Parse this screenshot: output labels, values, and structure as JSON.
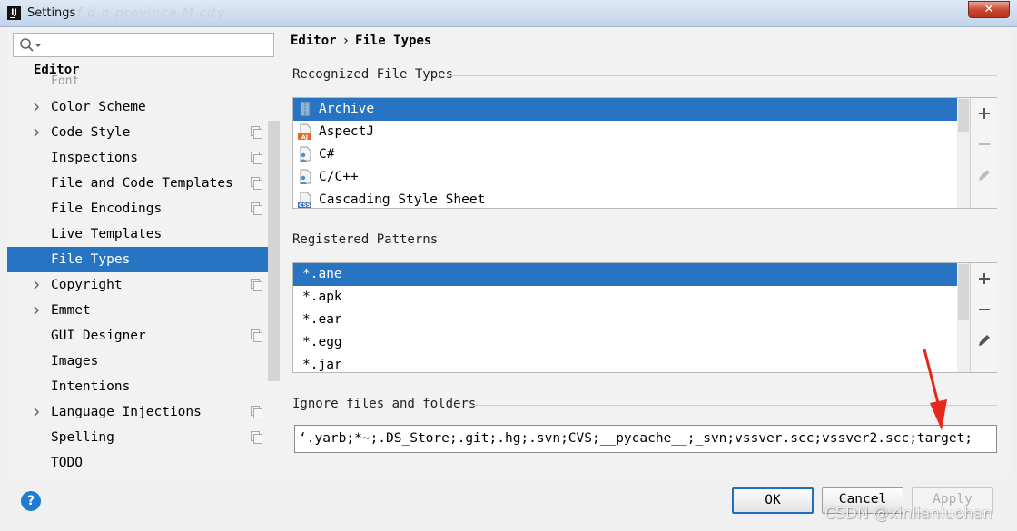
{
  "window": {
    "title": "Settings",
    "title_ghost": "f.d.n province M city",
    "close_label": "✕"
  },
  "search": {
    "value": ""
  },
  "tree": {
    "header": "Editor",
    "ghost": "Font",
    "items": [
      {
        "label": "Color Scheme",
        "expandable": true,
        "badge": false,
        "selected": false
      },
      {
        "label": "Code Style",
        "expandable": true,
        "badge": true,
        "selected": false
      },
      {
        "label": "Inspections",
        "expandable": false,
        "badge": true,
        "selected": false
      },
      {
        "label": "File and Code Templates",
        "expandable": false,
        "badge": true,
        "selected": false
      },
      {
        "label": "File Encodings",
        "expandable": false,
        "badge": true,
        "selected": false
      },
      {
        "label": "Live Templates",
        "expandable": false,
        "badge": false,
        "selected": false
      },
      {
        "label": "File Types",
        "expandable": false,
        "badge": false,
        "selected": true
      },
      {
        "label": "Copyright",
        "expandable": true,
        "badge": true,
        "selected": false
      },
      {
        "label": "Emmet",
        "expandable": true,
        "badge": false,
        "selected": false
      },
      {
        "label": "GUI Designer",
        "expandable": false,
        "badge": true,
        "selected": false
      },
      {
        "label": "Images",
        "expandable": false,
        "badge": false,
        "selected": false
      },
      {
        "label": "Intentions",
        "expandable": false,
        "badge": false,
        "selected": false
      },
      {
        "label": "Language Injections",
        "expandable": true,
        "badge": true,
        "selected": false
      },
      {
        "label": "Spelling",
        "expandable": false,
        "badge": true,
        "selected": false
      },
      {
        "label": "TODO",
        "expandable": false,
        "badge": false,
        "selected": false
      }
    ]
  },
  "breadcrumb": {
    "parent": "Editor",
    "separator": "›",
    "current": "File Types"
  },
  "recognized": {
    "title": "Recognized File Types",
    "items": [
      {
        "label": "Archive",
        "icon": "archive-icon",
        "tag": "",
        "selected": true
      },
      {
        "label": "AspectJ",
        "icon": "aspectj-file-icon",
        "tag": "AJ",
        "selected": false
      },
      {
        "label": "C#",
        "icon": "csharp-file-icon",
        "tag": "",
        "selected": false
      },
      {
        "label": "C/C++",
        "icon": "cpp-file-icon",
        "tag": "",
        "selected": false
      },
      {
        "label": "Cascading Style Sheet",
        "icon": "css-file-icon",
        "tag": "CSS",
        "selected": false
      }
    ]
  },
  "patterns": {
    "title": "Registered Patterns",
    "items": [
      {
        "label": "*.ane",
        "selected": true
      },
      {
        "label": "*.apk",
        "selected": false
      },
      {
        "label": "*.ear",
        "selected": false
      },
      {
        "label": "*.egg",
        "selected": false
      },
      {
        "label": "*.jar",
        "selected": false
      }
    ]
  },
  "ignore": {
    "title": "Ignore files and folders",
    "value": "‘.yarb;*~;.DS_Store;.git;.hg;.svn;CVS;__pycache__;_svn;vssver.scc;vssver2.scc;target;"
  },
  "buttons": {
    "help": "?",
    "ok": "OK",
    "cancel": "Cancel",
    "apply": "Apply"
  },
  "watermark": "CSDN @xinlianluohan",
  "colors": {
    "selection": "#2775c2",
    "arrow": "#e8261c",
    "help": "#1f7bd1"
  }
}
